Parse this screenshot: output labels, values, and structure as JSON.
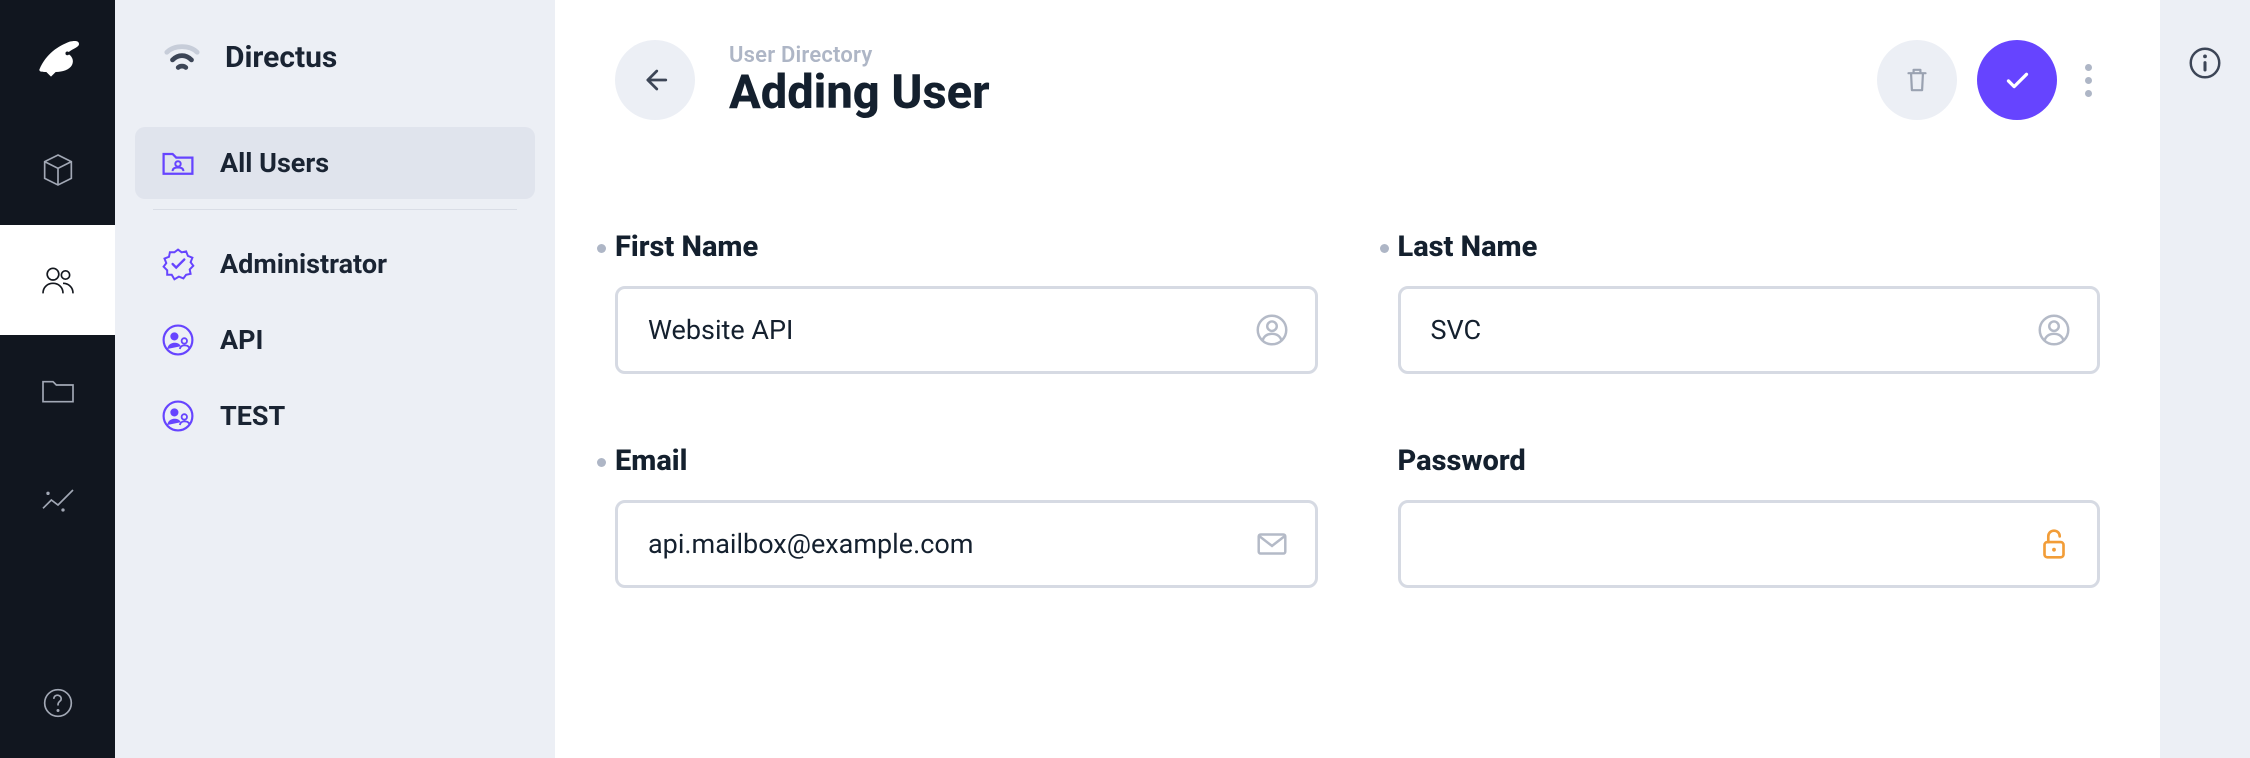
{
  "app": {
    "name": "Directus"
  },
  "rail": {
    "items": [
      {
        "id": "content",
        "icon": "cube-icon",
        "active": false
      },
      {
        "id": "users",
        "icon": "people-icon",
        "active": true
      },
      {
        "id": "files",
        "icon": "folder-icon",
        "active": false
      },
      {
        "id": "insights",
        "icon": "sparkline-icon",
        "active": false
      }
    ],
    "footer_icon": "help-icon"
  },
  "sidebar": {
    "title": "Directus",
    "items": [
      {
        "id": "all",
        "label": "All Users",
        "icon": "folder-user-icon",
        "active": true
      },
      {
        "id": "admin",
        "label": "Administrator",
        "icon": "verified-badge-icon",
        "active": false
      },
      {
        "id": "api",
        "label": "API",
        "icon": "supervised-user-icon",
        "active": false
      },
      {
        "id": "test",
        "label": "TEST",
        "icon": "supervised-user-icon",
        "active": false
      }
    ]
  },
  "header": {
    "breadcrumb": "User Directory",
    "title": "Adding User",
    "actions": {
      "delete_icon": "trash-icon",
      "save_icon": "check-icon",
      "more_icon": "kebab-icon"
    }
  },
  "form": {
    "first_name": {
      "label": "First Name",
      "value": "Website API",
      "icon": "person-icon",
      "edited": true
    },
    "last_name": {
      "label": "Last Name",
      "value": "SVC",
      "icon": "person-icon",
      "edited": true
    },
    "email": {
      "label": "Email",
      "value": "api.mailbox@example.com",
      "icon": "mail-icon",
      "edited": true
    },
    "password": {
      "label": "Password",
      "value": "",
      "icon": "lock-open-icon",
      "edited": false
    }
  },
  "colors": {
    "accent": "#6644ff",
    "rail_bg": "#11161f",
    "sidebar_bg": "#eceff5",
    "muted": "#aeb6c6",
    "warn": "#f29d38"
  }
}
